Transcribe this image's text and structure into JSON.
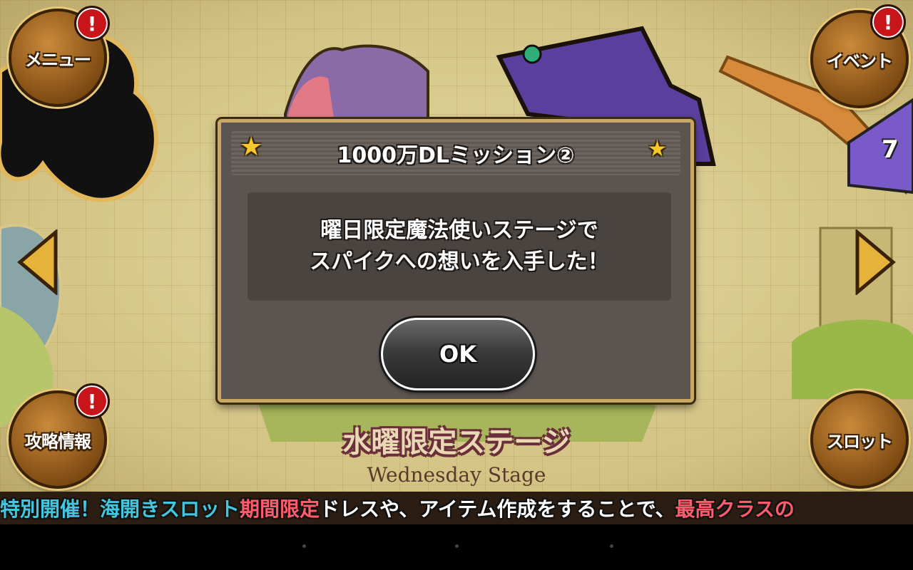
{
  "menu": {
    "label": "メニュー",
    "badge": "!"
  },
  "event": {
    "label": "イベント",
    "badge": "!"
  },
  "strategy": {
    "label": "攻略情報",
    "badge": "!"
  },
  "slot": {
    "label": "スロット"
  },
  "side_number": "7",
  "dialog": {
    "title": "1000万DLミッション②",
    "message_line1": "曜日限定魔法使いステージで",
    "message_line2": "スパイクへの想いを入手した！",
    "ok_label": "OK"
  },
  "stage": {
    "title_jp": "水曜限定ステージ",
    "title_en": "Wednesday Stage"
  },
  "ticker": [
    {
      "text": "特別開催！",
      "color": "#41c8e0"
    },
    {
      "text": "海開きスロット",
      "color": "#41c8e0"
    },
    {
      "text": "期間限定",
      "color": "#ff5b6b"
    },
    {
      "text": "ドレスや、アイテム作成をすることで、",
      "color": "#ffffff"
    },
    {
      "text": "最高クラスの",
      "color": "#ff5b6b"
    }
  ],
  "colors": {
    "accent_gold": "#c9a864",
    "dialog_bg": "#5b5450",
    "badge_red": "#c8151a"
  }
}
